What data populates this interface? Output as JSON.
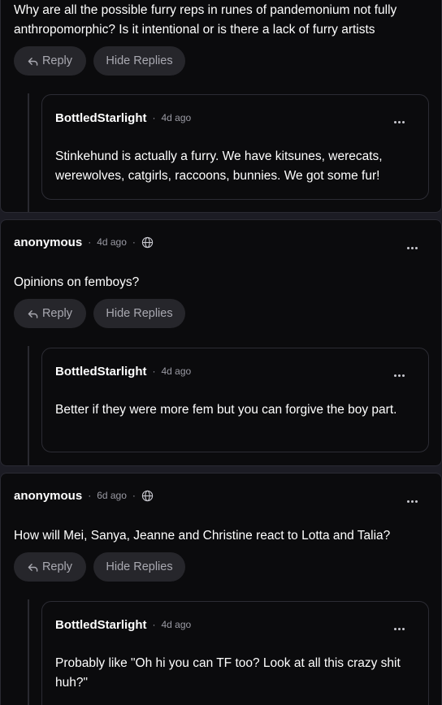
{
  "labels": {
    "reply": "Reply",
    "hide_replies": "Hide Replies",
    "separator": "·"
  },
  "comments": [
    {
      "text": "Why are all the possible furry reps in runes of pandemonium not fully anthropomorphic? Is it intentional or is there a lack of furry artists",
      "reply": {
        "author": "BottledStarlight",
        "time": "4d ago",
        "text": "Stinkehund is actually a furry. We have kitsunes, werecats, werewolves, catgirls, raccoons, bunnies. We got some fur!"
      }
    },
    {
      "author": "anonymous",
      "time": "4d ago",
      "visibility_icon": "globe-icon",
      "text": "Opinions on femboys?",
      "reply": {
        "author": "BottledStarlight",
        "time": "4d ago",
        "text": "Better if they were more fem but you can forgive the boy part."
      }
    },
    {
      "author": "anonymous",
      "time": "6d ago",
      "visibility_icon": "globe-icon",
      "text": "How will Mei, Sanya, Jeanne and Christine react to Lotta and Talia?",
      "reply": {
        "author": "BottledStarlight",
        "time": "4d ago",
        "text": "Probably like \"Oh hi you can TF too? Look at all this crazy shit huh?\""
      }
    }
  ],
  "colors": {
    "background": "#1c1c24",
    "card": "#0b0b0d",
    "button": "#26262b",
    "muted_text": "#9a9aa3"
  }
}
